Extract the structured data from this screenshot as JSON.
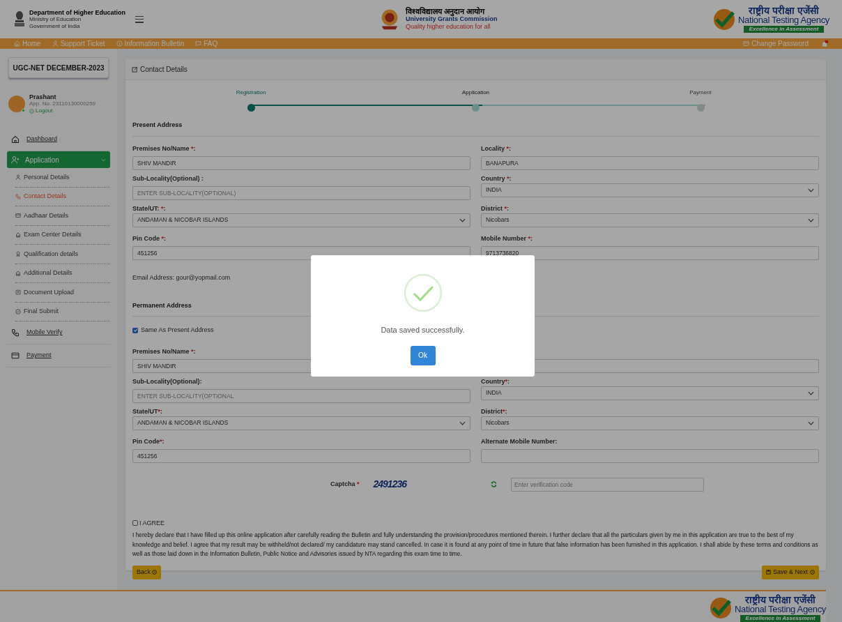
{
  "header": {
    "dept": {
      "title": "Department of Higher Education",
      "lines": [
        "Ministry of Education",
        "Government of India"
      ]
    },
    "ugc": {
      "hindi": "विश्वविद्यालय अनुदान आयोग",
      "english": "University Grants Commission",
      "tagline": "Quality higher education for all"
    },
    "nta": {
      "hindi": "राष्ट्रीय परीक्षा एजेंसी",
      "english": "National Testing Agency",
      "tagline": "Excellence in Assessment"
    }
  },
  "nav": {
    "items": [
      {
        "label": "Home",
        "kind": "home"
      },
      {
        "label": "Support Ticket",
        "kind": "user"
      },
      {
        "label": "Information Bulletin",
        "kind": "info"
      },
      {
        "label": "FAQ",
        "kind": "chat"
      }
    ],
    "change_password": "Change Password"
  },
  "sidebar": {
    "exam_title": "UGC-NET DECEMBER-2023",
    "user": {
      "name": "Prashant",
      "app_no": "App. No. 23110130000259",
      "logout": "Logout"
    },
    "menu": [
      {
        "label": "Dashboard",
        "kind": "home",
        "selected": false
      },
      {
        "label": "Application",
        "kind": "user-plus",
        "selected": true,
        "expanded": true,
        "children": [
          {
            "label": "Personal Details",
            "kind": "user",
            "selected": false
          },
          {
            "label": "Contact Details",
            "kind": "phone",
            "selected": true
          },
          {
            "label": "Aadhaar Details",
            "kind": "card",
            "selected": false
          },
          {
            "label": "Exam Center Details",
            "kind": "building",
            "selected": false
          },
          {
            "label": "Qualification details",
            "kind": "award",
            "selected": false
          },
          {
            "label": "Additional Details",
            "kind": "building",
            "selected": false
          },
          {
            "label": "Document Upload",
            "kind": "upload",
            "selected": false
          },
          {
            "label": "Final Submit",
            "kind": "check",
            "selected": false
          }
        ]
      },
      {
        "label": "Mobile Verify",
        "kind": "phone",
        "selected": false
      },
      {
        "label": "Payment",
        "kind": "card",
        "selected": false
      }
    ]
  },
  "form": {
    "title": "Contact Details",
    "steps": [
      {
        "label": "Registration",
        "done": true,
        "selected": false
      },
      {
        "label": "Application",
        "done": false,
        "selected": true
      },
      {
        "label": "Payment",
        "done": false,
        "selected": false
      }
    ],
    "present": {
      "title": "Present Address",
      "fields": [
        {
          "label": "Premises No/Name ",
          "mark": "*",
          "after": ":",
          "kind": "text",
          "value": "SHIV MANDIR"
        },
        {
          "label": "Locality ",
          "mark": "*",
          "after": ":",
          "kind": "text",
          "value": "BANAPURA"
        },
        {
          "label": "Sub-Locality(Optional) :",
          "kind": "text",
          "placeholder": "ENTER SUB-LOCALITY(OPTIONAL)"
        },
        {
          "label": "Country ",
          "mark": "*",
          "after": ":",
          "kind": "select",
          "value": "INDIA"
        },
        {
          "label": "State/UT: ",
          "mark": "*",
          "after": ":",
          "kind": "select",
          "value": "ANDAMAN & NICOBAR ISLANDS"
        },
        {
          "label": "District ",
          "mark": "*",
          "after": ":",
          "kind": "select",
          "value": "Nicobars"
        },
        {
          "label": "Pin Code ",
          "mark": "*",
          "after": ":",
          "kind": "text",
          "value": "451256"
        },
        {
          "label": "Mobile Number ",
          "mark": "*",
          "after": ":",
          "kind": "text",
          "value": "9713736820"
        }
      ],
      "email": "Email Address: gour@yopmail.com"
    },
    "permanent": {
      "title": "Permanent Address",
      "same_as_present": {
        "label": "Same As Present Address",
        "checked": true
      },
      "fields": [
        {
          "label": "Premises No/Name ",
          "mark": "*",
          "after": ":",
          "kind": "text",
          "value": "SHIV MANDIR"
        },
        {
          "kind": "text"
        },
        {
          "label": "Sub-Locality(Optional):",
          "kind": "text",
          "placeholder": "ENTER SUB-LOCALITY(OPTIONAL"
        },
        {
          "label": "Country",
          "mark": "*",
          "after": ":",
          "kind": "select",
          "value": "INDIA"
        },
        {
          "label": "State/UT",
          "mark": "*",
          "after": ":",
          "kind": "select",
          "value": "ANDAMAN & NICOBAR ISLANDS"
        },
        {
          "label": "District",
          "mark": "*",
          "after": ":",
          "kind": "select",
          "value": "Nicobars"
        },
        {
          "label": "Pin Code",
          "mark": "*",
          "after": ":",
          "kind": "text",
          "value": "451256"
        },
        {
          "label": "Alternate Mobile Number:",
          "kind": "text"
        }
      ]
    },
    "captcha": {
      "label": "Captcha ",
      "mark": "*",
      "code": "2491236",
      "placeholder": "Enter verification code"
    },
    "agree": {
      "label": "I AGREE",
      "checked": false
    },
    "declaration": "I hereby declare that I have filled up this online application after carefully reading the Bulletin and fully understanding the provision/procedures mentioned therein. I further declare that all the particulars given by me in this application are true to the best of my knowledge and belief. I agree that my result may be withheld/not declared/ my candidature may stand cancelled. In case it is found at any point of time in future that false information has been furnished in this application. I shall abide by these terms and conditions as well as those laid down in the Information Bulletin, Public Notice and Advisories issued by NTA regarding this exam time to time.",
    "back": "Back",
    "save": "Save & Next"
  },
  "modal": {
    "message": "Data saved successfully.",
    "ok": "Ok"
  },
  "footer": {
    "nta": {
      "hindi": "राष्ट्रीय परीक्षा एजेंसी",
      "english": "National Testing Agency",
      "tagline": "Excellence in Assessment"
    }
  }
}
